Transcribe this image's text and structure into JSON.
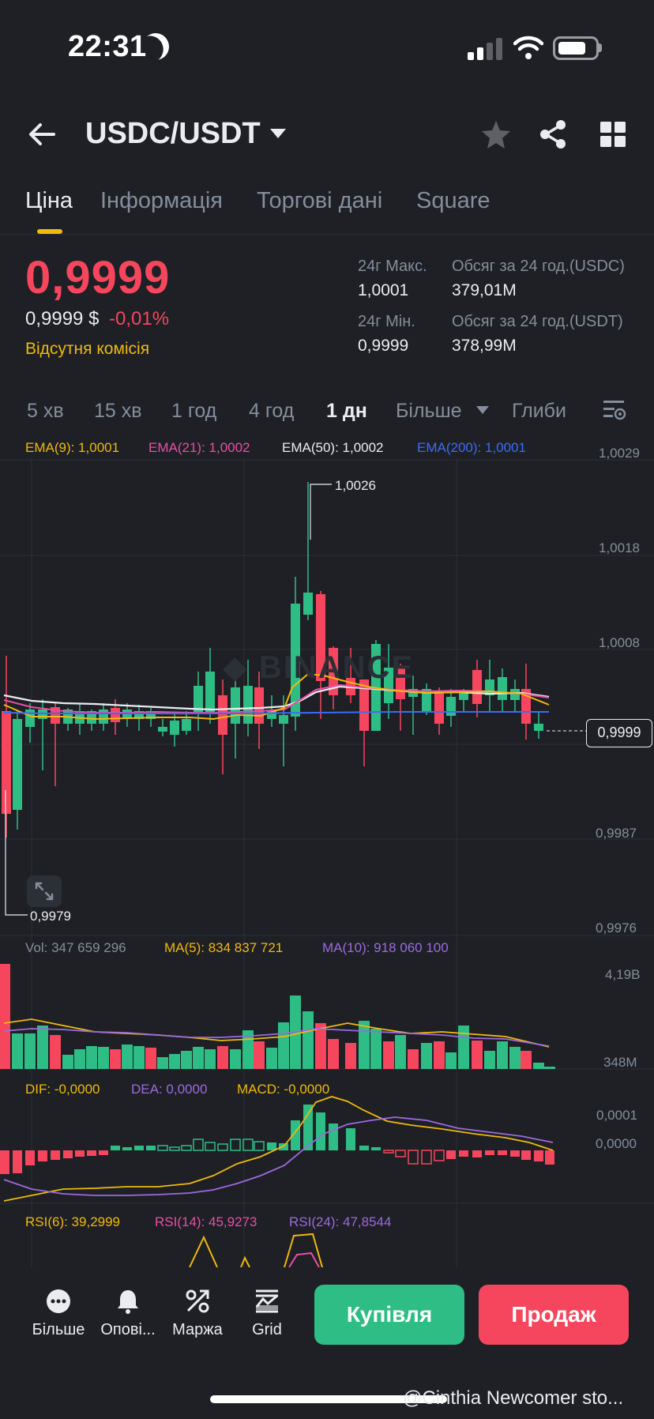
{
  "status": {
    "time": "22:31"
  },
  "header": {
    "pair": "USDC/USDT"
  },
  "tabs": [
    "Ціна",
    "Інформація",
    "Торгові дані",
    "Square"
  ],
  "price": {
    "last": "0,9999",
    "usd": "0,9999 $",
    "change": "-0,01%",
    "no_fee": "Відсутня комісія",
    "high_label": "24г Макс.",
    "high": "1,0001",
    "low_label": "24г Мін.",
    "low": "0,9999",
    "vol_usdc_label": "Обсяг за 24 год.(USDC)",
    "vol_usdc": "379,01M",
    "vol_usdt_label": "Обсяг за 24 год.(USDT)",
    "vol_usdt": "378,99M"
  },
  "intervals": [
    "5 хв",
    "15 хв",
    "1 год",
    "4 год",
    "1 дн",
    "Більше",
    "Глиби"
  ],
  "ema_legend": {
    "ema9": "EMA(9): 1,0001",
    "ema21": "EMA(21): 1,0002",
    "ema50": "EMA(50): 1,0002",
    "ema200": "EMA(200): 1,0001"
  },
  "price_axis": [
    "1,0029",
    "1,0018",
    "1,0008",
    "0,9987",
    "0,9976"
  ],
  "annotations": {
    "high": "1,0026",
    "low": "0,9979",
    "current": "0,9999"
  },
  "volume_legend": {
    "vol": "Vol: 347 659 296",
    "ma5": "MA(5): 834 837 721",
    "ma10": "MA(10): 918 060 100"
  },
  "volume_axis": [
    "4,19B",
    "348M"
  ],
  "macd_legend": {
    "dif": "DIF: -0,0000",
    "dea": "DEA: 0,0000",
    "macd": "MACD: -0,0000"
  },
  "macd_axis": [
    "0,0001",
    "0,0000"
  ],
  "rsi_legend": {
    "rsi6": "RSI(6): 39,2999",
    "rsi14": "RSI(14): 45,9273",
    "rsi24": "RSI(24): 47,8544"
  },
  "bottom_nav": [
    "Більше",
    "Опові...",
    "Маржа",
    "Grid"
  ],
  "actions": {
    "buy": "Купівля",
    "sell": "Продаж"
  },
  "watermark": "@Cinthia Newcomer sto...",
  "colors": {
    "up": "#2ebd85",
    "down": "#f6465d",
    "accent": "#f0b90b",
    "bg": "#1e2026"
  }
}
